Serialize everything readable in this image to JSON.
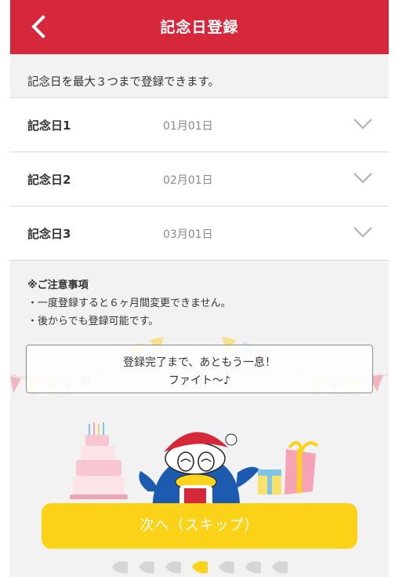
{
  "header": {
    "title": "記念日登録"
  },
  "intro": "記念日を最大３つまで登録できます。",
  "anniversaries": [
    {
      "label": "記念日1",
      "value": "01月01日"
    },
    {
      "label": "記念日2",
      "value": "02月01日"
    },
    {
      "label": "記念日3",
      "value": "03月01日"
    }
  ],
  "notes": {
    "title": "※ご注意事項",
    "items": [
      "・一度登録すると６ヶ月間変更できません。",
      "・後からでも登録可能です。"
    ]
  },
  "message": {
    "line1": "登録完了まで、あともう一息！",
    "line2": "ファイト～♪"
  },
  "next_button": "次へ（スキップ）",
  "pager": {
    "total": 7,
    "active": 4
  },
  "colors": {
    "header_bg": "#d7273a",
    "button_bg": "#fcd218",
    "page_bg": "#f2f2f2"
  },
  "icons": {
    "back": "chevron-left-icon",
    "expand": "chevron-down-icon"
  }
}
